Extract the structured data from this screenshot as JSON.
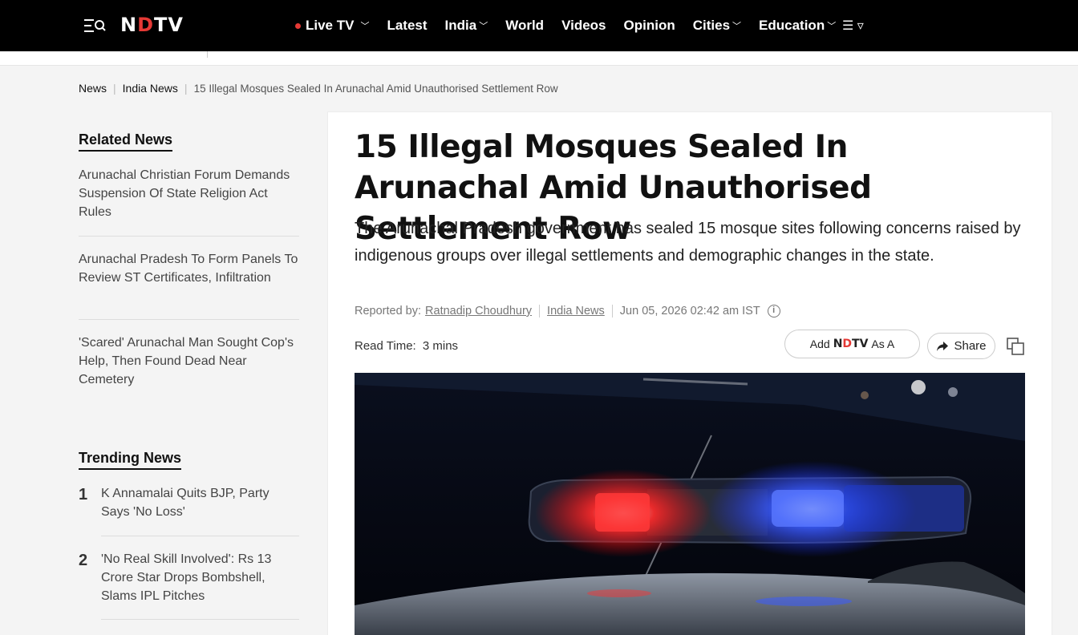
{
  "header": {
    "logo": {
      "left": "N",
      "dot": "D",
      "right": "TV"
    },
    "nav": [
      {
        "label": "Live TV",
        "live": true,
        "caret": "﹀"
      },
      {
        "label": "Latest"
      },
      {
        "label": "India",
        "caret": "﹀"
      },
      {
        "label": "World"
      },
      {
        "label": "Videos"
      },
      {
        "label": "Opinion"
      },
      {
        "label": "Cities",
        "caret": "﹀"
      },
      {
        "label": "Education",
        "caret": "﹀"
      }
    ],
    "more_icon": "☰ ▿"
  },
  "breadcrumb": {
    "items": [
      "News",
      "India News"
    ],
    "current": "15 Illegal Mosques Sealed In Arunachal Amid Unauthorised Settlement Row"
  },
  "sidebar": {
    "related_heading": "Related News",
    "related": [
      "Arunachal Christian Forum Demands Suspension Of State Religion Act Rules",
      "Arunachal Pradesh To Form Panels To Review ST Certificates, Infiltration",
      "'Scared' Arunachal Man Sought Cop's Help, Then Found Dead Near Cemetery"
    ],
    "trending_heading": "Trending News",
    "trending": [
      {
        "num": "1",
        "title": "K Annamalai Quits BJP, Party Says 'No Loss'"
      },
      {
        "num": "2",
        "title": "'No Real Skill Involved': Rs 13 Crore Star Drops Bombshell, Slams IPL Pitches"
      }
    ]
  },
  "article": {
    "headline": "15 Illegal Mosques Sealed In Arunachal Amid Unauthorised Settlement Row",
    "summary": "The Arunachal Pradesh government has sealed 15 mosque sites following concerns raised by indigenous groups over illegal settlements and demographic changes in the state.",
    "reported_by_label": "Reported by:",
    "author": "Ratnadip Choudhury",
    "section": "India News",
    "datetime": "Jun 05, 2026 02:42 am IST",
    "info_icon": "i",
    "read_time_label": "Read Time:",
    "read_time": "3 mins",
    "add_button": {
      "prefix": "Add",
      "brand_left": "N",
      "brand_dot": "D",
      "brand_right": "TV",
      "suffix": "As A"
    },
    "share_label": "Share"
  },
  "colors": {
    "accent_red": "#e53935",
    "topbar_bg": "#000000",
    "page_bg": "#f4f4f4"
  }
}
